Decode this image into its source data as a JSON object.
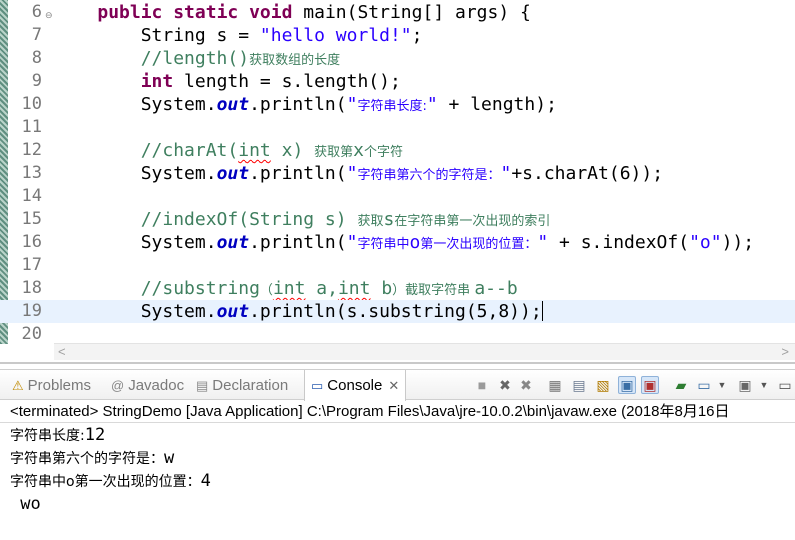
{
  "editor": {
    "lines": [
      {
        "num": "6",
        "fold": "⊖",
        "parts": [
          [
            "    ",
            ""
          ],
          [
            "public static void",
            "kw"
          ],
          [
            " main(String[] args) {",
            ""
          ]
        ]
      },
      {
        "num": "7",
        "parts": [
          [
            "        String s = ",
            ""
          ],
          [
            "\"hello world!\"",
            "str"
          ],
          [
            ";",
            ""
          ]
        ]
      },
      {
        "num": "8",
        "parts": [
          [
            "        ",
            ""
          ],
          [
            "//length()",
            "cm"
          ],
          [
            "获取数组的长度",
            "cm cjk"
          ]
        ]
      },
      {
        "num": "9",
        "parts": [
          [
            "        ",
            ""
          ],
          [
            "int",
            "kw"
          ],
          [
            " length = s.length();",
            ""
          ]
        ]
      },
      {
        "num": "10",
        "parts": [
          [
            "        System.",
            ""
          ],
          [
            "out",
            "fld"
          ],
          [
            ".println(",
            ""
          ],
          [
            "\"",
            "str"
          ],
          [
            "字符串长度:",
            "str cjk"
          ],
          [
            "\"",
            "str"
          ],
          [
            " + length);",
            ""
          ]
        ]
      },
      {
        "num": "11",
        "parts": []
      },
      {
        "num": "12",
        "parts": [
          [
            "        ",
            ""
          ],
          [
            "//charAt(",
            "cm"
          ],
          [
            "int",
            "cm sq"
          ],
          [
            " x) ",
            "cm"
          ],
          [
            "获取第",
            "cm cjk"
          ],
          [
            "x",
            "cm"
          ],
          [
            "个字符",
            "cm cjk"
          ]
        ]
      },
      {
        "num": "13",
        "parts": [
          [
            "        System.",
            ""
          ],
          [
            "out",
            "fld"
          ],
          [
            ".println(",
            ""
          ],
          [
            "\"",
            "str"
          ],
          [
            "字符串第六个的字符是：",
            "str cjk"
          ],
          [
            "\"",
            "str"
          ],
          [
            "+s.charAt(6));",
            ""
          ]
        ]
      },
      {
        "num": "14",
        "parts": []
      },
      {
        "num": "15",
        "parts": [
          [
            "        ",
            ""
          ],
          [
            "//indexOf(String s) ",
            "cm"
          ],
          [
            "获取",
            "cm cjk"
          ],
          [
            "s",
            "cm"
          ],
          [
            "在字符串第一次出现的索引",
            "cm cjk"
          ]
        ]
      },
      {
        "num": "16",
        "parts": [
          [
            "        System.",
            ""
          ],
          [
            "out",
            "fld"
          ],
          [
            ".println(",
            ""
          ],
          [
            "\"",
            "str"
          ],
          [
            "字符串中",
            "str cjk"
          ],
          [
            "o",
            "str"
          ],
          [
            "第一次出现的位置：",
            "str cjk"
          ],
          [
            "\"",
            "str"
          ],
          [
            " + s.indexOf(",
            ""
          ],
          [
            "\"o\"",
            "str"
          ],
          [
            "));",
            ""
          ]
        ]
      },
      {
        "num": "17",
        "parts": []
      },
      {
        "num": "18",
        "parts": [
          [
            "        ",
            ""
          ],
          [
            "//substring",
            "cm"
          ],
          [
            "（",
            "cm cjk"
          ],
          [
            "int",
            "cm sq"
          ],
          [
            " a,",
            "cm"
          ],
          [
            "int",
            "cm sq"
          ],
          [
            " b",
            "cm"
          ],
          [
            "）截取字符串 ",
            "cm cjk"
          ],
          [
            "a--b",
            "cm"
          ]
        ]
      },
      {
        "num": "19",
        "parts": [
          [
            "        System.",
            ""
          ],
          [
            "out",
            "fld"
          ],
          [
            ".println(s.substring(5,8));",
            ""
          ]
        ],
        "current": true
      },
      {
        "num": "20",
        "parts": []
      }
    ],
    "scroll_left": "<",
    "scroll_right": ">"
  },
  "views": {
    "tabs": [
      {
        "label": "Problems",
        "icon": "⚠",
        "name": "tab-problems"
      },
      {
        "label": "Javadoc",
        "icon": "@",
        "name": "tab-javadoc"
      },
      {
        "label": "Declaration",
        "icon": "▤",
        "name": "tab-declaration"
      },
      {
        "label": "Console",
        "icon": "▭",
        "name": "tab-console",
        "close": "✕"
      }
    ]
  },
  "console": {
    "status": "<terminated> StringDemo [Java Application] C:\\Program Files\\Java\\jre-10.0.2\\bin\\javaw.exe (2018年8月16日",
    "output": [
      {
        "cjk": "字符串长度:",
        "rest": "12"
      },
      {
        "cjk": "字符串第六个的字符是：",
        "rest": "w"
      },
      {
        "cjk": "字符串中o第一次出现的位置：",
        "rest": "4"
      },
      {
        "cjk": "",
        "rest": " wo"
      }
    ]
  }
}
